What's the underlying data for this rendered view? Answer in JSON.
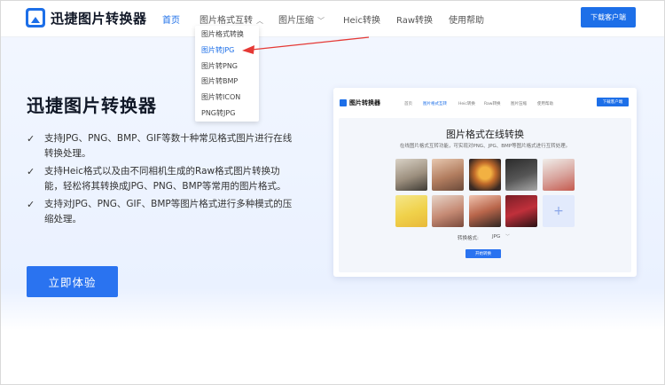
{
  "app": {
    "name": "迅捷图片转换器"
  },
  "nav": {
    "items": [
      {
        "label": "首页"
      },
      {
        "label": "图片格式互转"
      },
      {
        "label": "图片压缩"
      },
      {
        "label": "Heic转换"
      },
      {
        "label": "Raw转换"
      },
      {
        "label": "使用帮助"
      }
    ],
    "download_label": "下载客户端"
  },
  "dropdown": {
    "items": [
      {
        "label": "图片格式转换"
      },
      {
        "label": "图片转JPG"
      },
      {
        "label": "图片转PNG"
      },
      {
        "label": "图片转BMP"
      },
      {
        "label": "图片转ICON"
      },
      {
        "label": "PNG转JPG"
      }
    ],
    "highlight_color": "#1d6fe8"
  },
  "hero": {
    "title": "迅捷图片转换器",
    "features": [
      "支持JPG、PNG、BMP、GIF等数十种常见格式图片进行在线转换处理。",
      "支持Heic格式以及由不同相机生成的Raw格式图片转换功能，轻松将其转换成JPG、PNG、BMP等常用的图片格式。",
      "支持对JPG、PNG、GIF、BMP等图片格式进行多种模式的压缩处理。"
    ],
    "cta_label": "立即体验"
  },
  "preview": {
    "logo": "图片转换器",
    "nav": [
      "首页",
      "图片格式互转",
      "Heic转换",
      "Raw转换",
      "图片压缩",
      "使用帮助"
    ],
    "download_label": "下载客户端",
    "title": "图片格式在线转换",
    "subtitle": "在线图片格式互转功能，可实现对PNG、JPG、BMP等图片格式进行互转处理。",
    "format_label": "转换格式:",
    "format_value": "JPG",
    "start_label": "开始转换",
    "plus": "+"
  },
  "colors": {
    "accent": "#1d6fe8",
    "arrow": "#e53935"
  }
}
